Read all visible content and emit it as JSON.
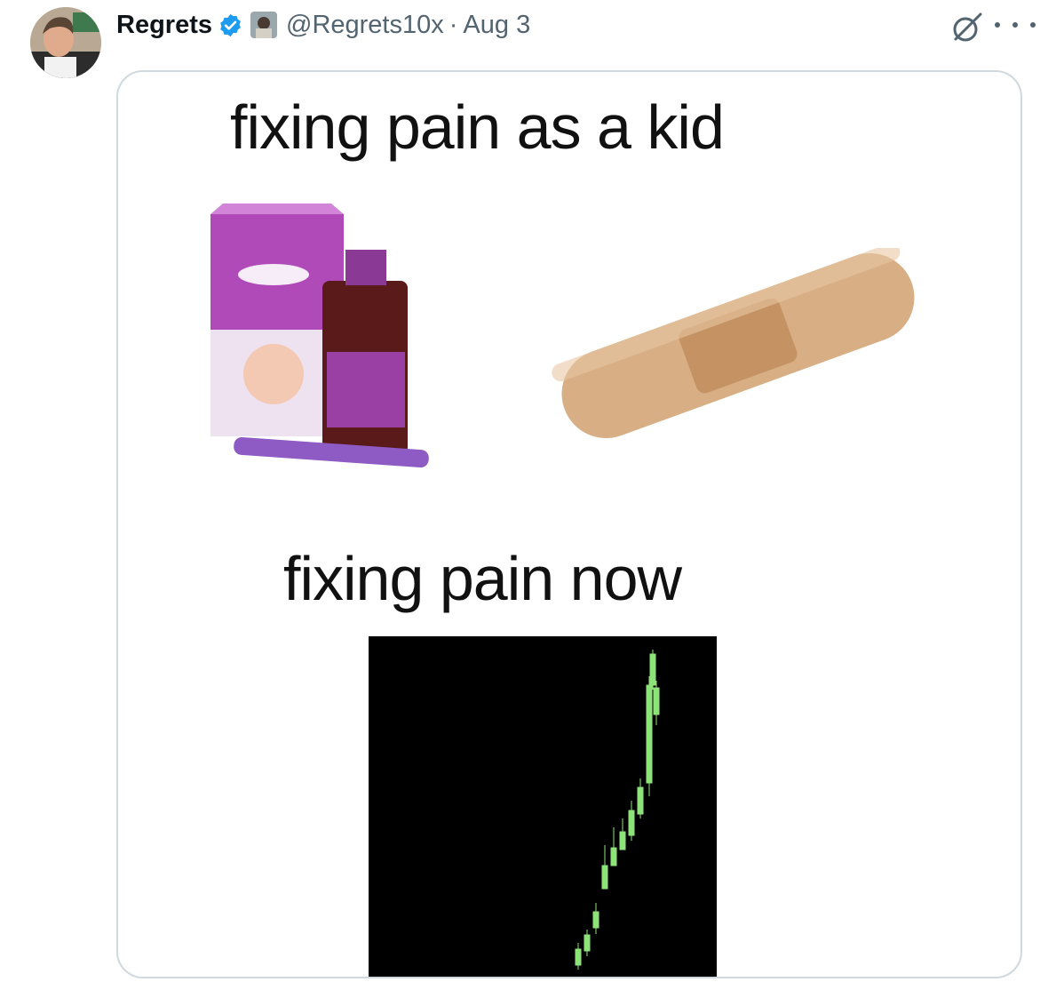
{
  "tweet": {
    "author_name": "Regrets",
    "handle": "@Regrets10x",
    "separator": "·",
    "date": "Aug 3",
    "icons": {
      "verified": "verified-badge-icon",
      "grok": "grok-icon",
      "more": "more-options-icon"
    },
    "colors": {
      "verified": "#1d9bf0",
      "secondary_text": "#536471",
      "chart_candle": "#8ee27a"
    }
  },
  "media": {
    "caption_top": "fixing pain as a kid",
    "caption_bottom": "fixing pain now",
    "images": [
      "calpol-medicine-image",
      "bandage-image",
      "candlestick-chart-image"
    ]
  }
}
